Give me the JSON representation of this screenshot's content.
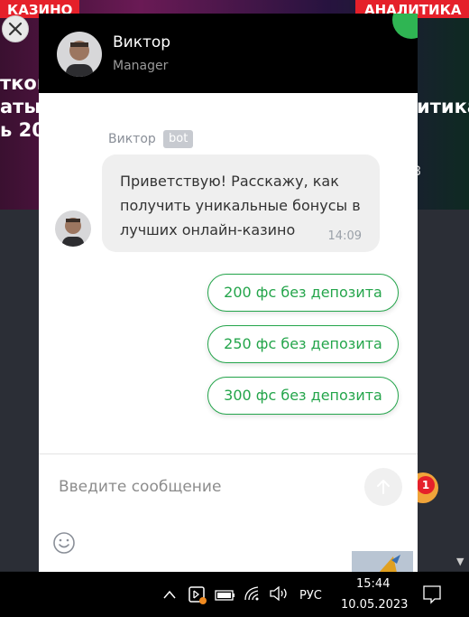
{
  "background": {
    "tag_left": "КАЗИНО",
    "tag_right": "АНАЛИТИКА",
    "left_lines": [
      "ткова",
      "аты",
      "ь 20"
    ],
    "right_lines": [
      "итика"
    ],
    "right_num": "8",
    "bell_badge": "1"
  },
  "chat": {
    "header": {
      "name": "Виктор",
      "role": "Manager"
    },
    "message": {
      "sender": "Виктор",
      "badge": "bot",
      "text": "Приветствую! Расскажу, как получить уникальные бонусы в лучших онлайн-казино",
      "time": "14:09"
    },
    "quick_replies": [
      "200 фс без депозита",
      "250 фс без депозита",
      "300 фс без депозита"
    ],
    "input": {
      "placeholder": "Введите сообщение"
    }
  },
  "taskbar": {
    "language": "РУС",
    "time": "15:44",
    "date": "10.05.2023"
  },
  "colors": {
    "accent": "#24a54b",
    "header_bg": "#000000",
    "badge_red": "#e5202a"
  }
}
